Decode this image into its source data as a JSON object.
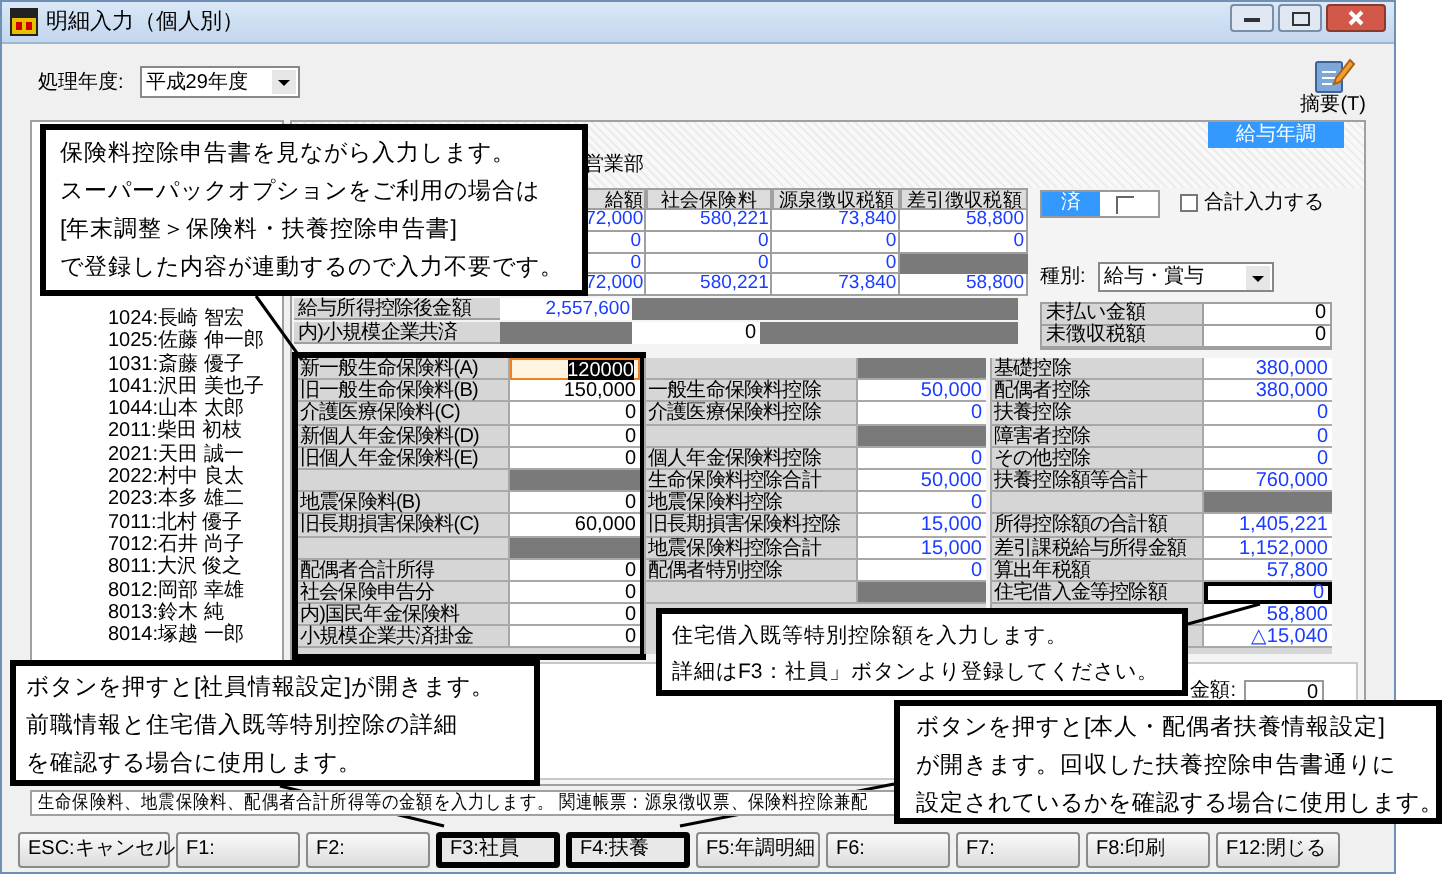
{
  "window": {
    "title": "明細入力（個人別）"
  },
  "toolbar": {
    "year_label": "処理年度:",
    "year_value": "平成29年度",
    "summary_button": "摘要(T)"
  },
  "employee_list": {
    "items": [
      {
        "label": "1024:長崎 智宏",
        "selected": false
      },
      {
        "label": "1025:佐藤 伸一郎",
        "selected": false
      },
      {
        "label": "1031:斎藤 優子",
        "selected": false
      },
      {
        "label": "1041:沢田 美也子",
        "selected": false
      },
      {
        "label": "1044:山本 太郎",
        "selected": false
      },
      {
        "label": "2011:柴田 初枝",
        "selected": false
      },
      {
        "label": "2021:天田 誠一",
        "selected": false
      },
      {
        "label": "2022:村中 良太",
        "selected": false
      },
      {
        "label": "2023:本多 雄二",
        "selected": false
      },
      {
        "label": "7011:北村 優子",
        "selected": false
      },
      {
        "label": "7012:石井 尚子",
        "selected": false
      },
      {
        "label": "8011:大沢 俊之",
        "selected": false
      },
      {
        "label": "8012:岡部 幸雄",
        "selected": false
      },
      {
        "label": "8013:鈴木 純",
        "selected": false
      },
      {
        "label": "8014:塚越 一郎",
        "selected": false
      }
    ]
  },
  "detail": {
    "department": "営業部",
    "mode_badge": "給与年調",
    "summary_table": {
      "columns": [
        "給額",
        "社会保険料",
        "源泉徴収税額",
        "差引徴収税額"
      ],
      "rows": [
        {
          "cells": [
            "72,000",
            "580,221",
            "73,840",
            "58,800"
          ]
        },
        {
          "cells": [
            "0",
            "0",
            "0",
            "0"
          ]
        },
        {
          "cells": [
            "0",
            "0",
            "0"
          ],
          "shaded_end": true
        },
        {
          "cells": [
            "72,000",
            "580,221",
            "73,840",
            "58,800"
          ]
        }
      ]
    },
    "income_rows": [
      {
        "kind": "first",
        "label": "給与所得控除後金額",
        "value": "2,557,600"
      },
      {
        "kind": "second",
        "label": "内)小規模企業共済",
        "value": "0"
      }
    ],
    "status_toggle": {
      "label": "済",
      "on": true
    },
    "total_input": {
      "label": "合計入力する",
      "checked": false
    },
    "type_select": {
      "label": "種別:",
      "value": "給与・賞与"
    },
    "unpaid": [
      {
        "label": "未払い金額",
        "value": "0"
      },
      {
        "label": "未徴収税額",
        "value": "0"
      }
    ],
    "grid": [
      {
        "computed": false,
        "highlighted": true,
        "rows": [
          {
            "kind": "field",
            "label": "新一般生命保険料(A)",
            "value": "120000",
            "focused": true
          },
          {
            "kind": "field",
            "label": "旧一般生命保険料(B)",
            "value": "150,000",
            "focused": false
          },
          {
            "kind": "field",
            "label": "介護医療保険料(C)",
            "value": "0",
            "focused": false
          },
          {
            "kind": "field",
            "label": "新個人年金保険料(D)",
            "value": "0",
            "focused": false
          },
          {
            "kind": "field",
            "label": "旧個人年金保険料(E)",
            "value": "0",
            "focused": false
          },
          {
            "kind": "blank"
          },
          {
            "kind": "field",
            "label": "地震保険料(B)",
            "value": "0",
            "focused": false
          },
          {
            "kind": "field",
            "label": "旧長期損害保険料(C)",
            "value": "60,000",
            "focused": false
          },
          {
            "kind": "blank"
          },
          {
            "kind": "field",
            "label": "配偶者合計所得",
            "value": "0",
            "focused": false
          },
          {
            "kind": "field",
            "label": "社会保険申告分",
            "value": "0",
            "focused": false
          },
          {
            "kind": "field",
            "label": "内)国民年金保険料",
            "value": "0",
            "focused": false
          },
          {
            "kind": "field",
            "label": "小規模企業共済掛金",
            "value": "0",
            "focused": false
          }
        ]
      },
      {
        "computed": true,
        "highlighted": false,
        "rows": [
          {
            "kind": "blank"
          },
          {
            "kind": "field",
            "label": "一般生命保険料控除",
            "value": "50,000"
          },
          {
            "kind": "field",
            "label": "介護医療保険料控除",
            "value": "0"
          },
          {
            "kind": "blank"
          },
          {
            "kind": "field",
            "label": "個人年金保険料控除",
            "value": "0"
          },
          {
            "kind": "field",
            "label": "生命保険料控除合計",
            "value": "50,000"
          },
          {
            "kind": "field",
            "label": "地震保険料控除",
            "value": "0"
          },
          {
            "kind": "field",
            "label": "旧長期損害保険料控除",
            "value": "15,000"
          },
          {
            "kind": "field",
            "label": "地震保険料控除合計",
            "value": "15,000"
          },
          {
            "kind": "field",
            "label": "配偶者特別控除",
            "value": "0"
          },
          {
            "kind": "blank"
          }
        ]
      },
      {
        "computed": true,
        "highlighted": false,
        "rows": [
          {
            "kind": "field",
            "label": "基礎控除",
            "value": "380,000",
            "highlighted": false
          },
          {
            "kind": "field",
            "label": "配偶者控除",
            "value": "380,000",
            "highlighted": false
          },
          {
            "kind": "field",
            "label": "扶養控除",
            "value": "0",
            "highlighted": false
          },
          {
            "kind": "field",
            "label": "障害者控除",
            "value": "0",
            "highlighted": false
          },
          {
            "kind": "field",
            "label": "その他控除",
            "value": "0",
            "highlighted": false
          },
          {
            "kind": "field",
            "label": "扶養控除額等合計",
            "value": "760,000",
            "highlighted": false
          },
          {
            "kind": "blank"
          },
          {
            "kind": "field",
            "label": "所得控除額の合計額",
            "value": "1,405,221",
            "highlighted": false
          },
          {
            "kind": "field",
            "label": "差引課税給与所得金額",
            "value": "1,152,000",
            "highlighted": false
          },
          {
            "kind": "field",
            "label": "算出年税額",
            "value": "57,800",
            "highlighted": false
          },
          {
            "kind": "field",
            "label": "住宅借入金等控除額",
            "value": "0",
            "highlighted": true
          },
          {
            "kind": "value",
            "value": "58,800",
            "highlighted": false
          },
          {
            "kind": "value",
            "value": "△15,040",
            "highlighted": false
          }
        ]
      }
    ],
    "settlement": {
      "label": "金額:",
      "value": "0"
    }
  },
  "status_bar": "生命保険料、地震保険料、配偶者合計所得等の金額を入力します。 関連帳票：源泉徴収票、保険料控除兼配",
  "function_keys": [
    {
      "label": "ESC:キャンセル",
      "highlighted": false
    },
    {
      "label": "F1:",
      "highlighted": false
    },
    {
      "label": "F2:",
      "highlighted": false
    },
    {
      "label": "F3:社員",
      "highlighted": true
    },
    {
      "label": "F4:扶養",
      "highlighted": true
    },
    {
      "label": "F5:年調明細",
      "highlighted": false
    },
    {
      "label": "F6:",
      "highlighted": false
    },
    {
      "label": "F7:",
      "highlighted": false
    },
    {
      "label": "F8:印刷",
      "highlighted": false
    },
    {
      "label": "F12:閉じる",
      "highlighted": false
    }
  ],
  "callouts": [
    {
      "lines": [
        "保険料控除申告書を見ながら入力します。",
        "スーパーパックオプションをご利用の場合は",
        "[年末調整＞保険料・扶養控除申告書]",
        "で登録した内容が連動するので入力不要です。"
      ]
    },
    {
      "lines": [
        "住宅借入既等特別控除額を入力します。",
        "詳細はF3：社員」ボタンより登録してください。"
      ]
    },
    {
      "lines": [
        "ボタンを押すと[社員情報設定]が開きます。",
        "前職情報と住宅借入既等特別控除の詳細",
        "を確認する場合に使用します。"
      ]
    },
    {
      "lines": [
        "ボタンを押すと[本人・配偶者扶養情報設定]",
        "が開きます。回収した扶養控除申告書通りに",
        "設定されているかを確認する場合に使用します。"
      ]
    }
  ]
}
